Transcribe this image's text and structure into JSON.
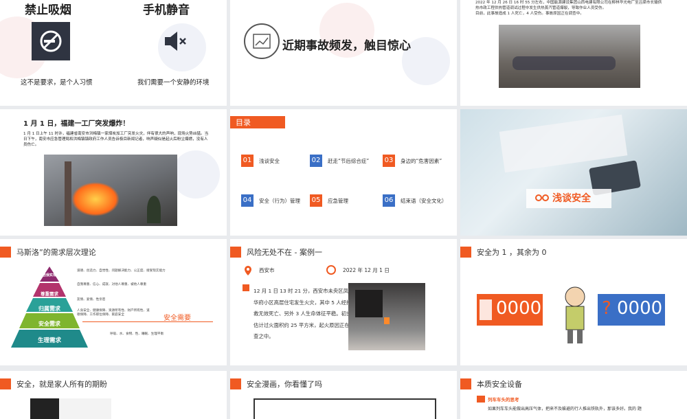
{
  "s1": {
    "left_title": "禁止吸烟",
    "right_title": "手机静音",
    "left_caption": "这不是要求，是个人习惯",
    "right_caption": "我们需要一个安静的环境"
  },
  "s2": {
    "title": "近期事故频发，触目惊心"
  },
  "s3": {
    "line1": "2022 年 12 月 26 日 16 时 55 分左右，中国能源建设集团山西电建有限公司在柳林华光电厂至吕梁市长输供",
    "line2": "热市政工程供热管道调试过程中发生供热蒸汽管道爆裂，导致作业人员受伤。",
    "line3": "目前，此事故造成 1 人死亡，4 人受伤。事故原因正在调查中。"
  },
  "s4": {
    "title": "1 月 1 日，福建一工厂突发爆炸！",
    "body": "1 月 1 日上午 11 时许，福建省南安市洪梅镇一家煤炭加工厂突发火灾，伴有很大的声响，现场火势凶猛。当日下午，南安市应急管理局和洪梅镇镇政府工作人员告诉极目新闻记者，响声疑似是起火后粉尘爆燃，没有人员伤亡。"
  },
  "s5": {
    "header": "目录",
    "items": [
      {
        "num": "01",
        "label": "浅谈安全",
        "color": "#f05a22"
      },
      {
        "num": "02",
        "label": "赶走“节后综合症”",
        "color": "#3a6fc6"
      },
      {
        "num": "03",
        "label": "身边的“危害因素”",
        "color": "#f05a22"
      },
      {
        "num": "04",
        "label": "安全（行为）管理",
        "color": "#3a6fc6"
      },
      {
        "num": "05",
        "label": "应急管理",
        "color": "#f05a22"
      },
      {
        "num": "06",
        "label": "结束语（安全文化）",
        "color": "#3a6fc6"
      }
    ]
  },
  "s6": {
    "title": "浅谈安全"
  },
  "s7": {
    "title": "马斯洛”的需求层次理论",
    "levels": [
      "自我实现",
      "尊重需求",
      "归属需求",
      "安全需求",
      "生理需求"
    ],
    "notes": [
      "道德、创造力、自觉性、问题解决能力、公正度、接受现实能力",
      "自我尊重、信心、成就、对他人尊重、被他人尊重",
      "友情、爱情、性亲密",
      "人身安全、健康保障、资源所有性、财产所有性、道德保障、工作职位保障、家庭安全",
      "呼吸、水、食物、性、睡眠、生理平衡"
    ],
    "highlight": "安全需要"
  },
  "s8": {
    "title": "风险无处不在 - 案例一",
    "place": "西安市",
    "date": "2022 年 12 月 1 日",
    "body": "12 月 1 日 13 时 21 分，西安市未央区凤鸣华府小区高层住宅发生火灾，其中 5 人经抢救无效死亡、另外 3 人生命体征平稳。初步估计过火面积约 25 平方米，起火原因正在调查之中。"
  },
  "s9": {
    "title": "安全为 1 ，其余为 0",
    "left": "0000",
    "right": "0000",
    "question": "?"
  },
  "s10": {
    "title": "安全，就是家人所有的期盼"
  },
  "s11": {
    "title": "安全漫画，你看懂了吗"
  },
  "s12": {
    "title": "本质安全设备",
    "sub": "列车车头的思考",
    "body": "如果列车车头能做出高压气体，把来不及躲避的行人推出铁轨外，那该多好。我的 题"
  },
  "colors": {
    "accent": "#f05a22",
    "blue": "#3a6fc6"
  }
}
